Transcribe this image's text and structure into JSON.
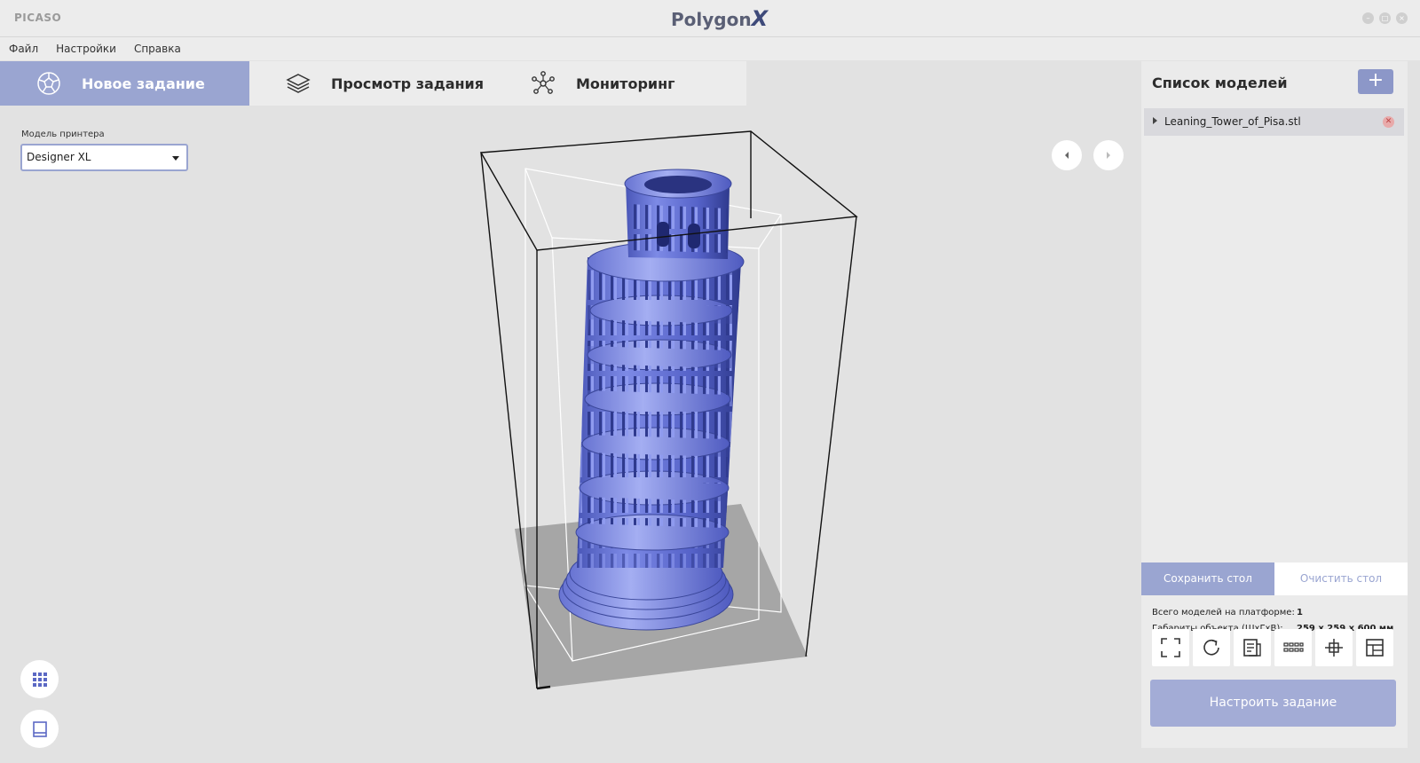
{
  "window": {
    "brand": "PICASO",
    "title": "Polygon",
    "title_suffix": "X"
  },
  "menu": {
    "items": [
      "Файл",
      "Настройки",
      "Справка"
    ]
  },
  "tabs": [
    {
      "label": "Новое задание",
      "active": true,
      "icon": "polyhedron-icon"
    },
    {
      "label": "Просмотр задания",
      "active": false,
      "icon": "layers-icon"
    },
    {
      "label": "Мониторинг",
      "active": false,
      "icon": "network-icon"
    }
  ],
  "printer": {
    "label": "Модель принтера",
    "value": "Designer XL"
  },
  "panel": {
    "title": "Список моделей",
    "add_label": "+",
    "models": [
      {
        "name": "Leaning_Tower_of_Pisa.stl"
      }
    ],
    "save_label": "Сохранить стол",
    "clear_label": "Очистить стол",
    "count_label": "Всего моделей на платформе:",
    "count_value": "1",
    "dims_label": "Габариты объекта (ШхГхВ):",
    "dims_value": "259 x 259 x 600 мм",
    "configure_label": "Настроить задание"
  },
  "colors": {
    "accent": "#9aa5d1",
    "model": "#6a78d8",
    "background": "#e2e2e2"
  }
}
